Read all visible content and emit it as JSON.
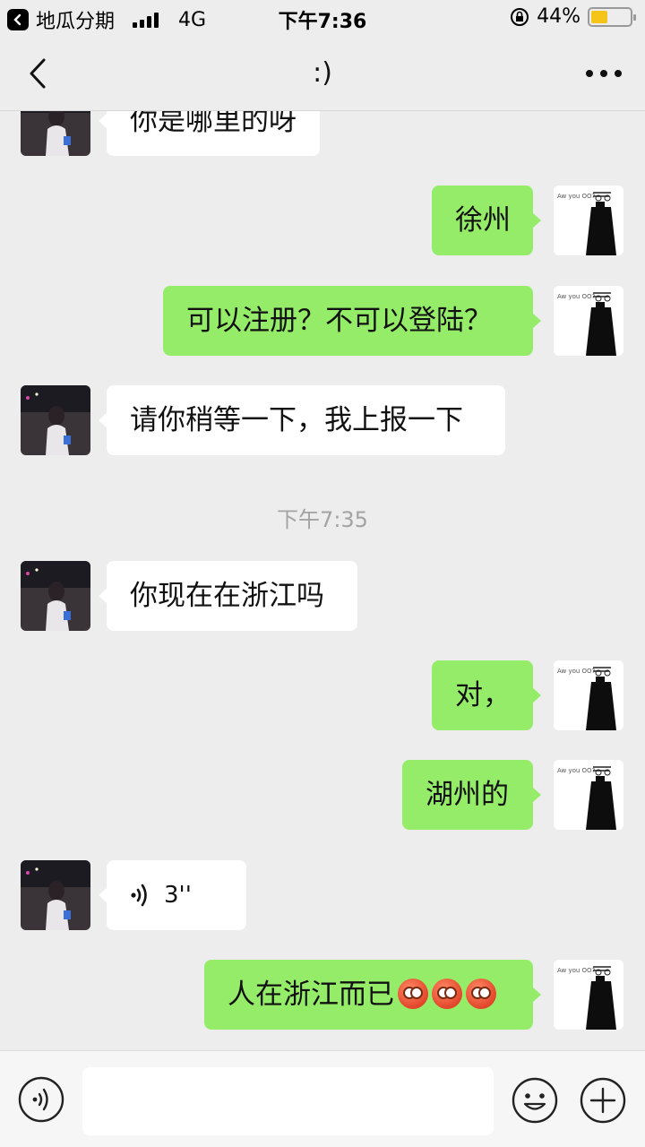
{
  "status_bar": {
    "carrier_app": "地瓜分期",
    "network": "4G",
    "time": "下午7:36",
    "battery_percent": "44%",
    "battery_level": 0.44
  },
  "nav": {
    "title": ":)"
  },
  "messages": [
    {
      "side": "left",
      "type": "text",
      "text": "你是哪里的呀"
    },
    {
      "side": "right",
      "type": "text",
      "text": "徐州"
    },
    {
      "side": "right",
      "type": "text",
      "text": "可以注册？不可以登陆？"
    },
    {
      "side": "left",
      "type": "text",
      "text": "请你稍等一下，我上报一下"
    },
    {
      "type": "timestamp",
      "text": "下午7:35"
    },
    {
      "side": "left",
      "type": "text",
      "text": "你现在在浙江吗"
    },
    {
      "side": "right",
      "type": "text",
      "text": "对，"
    },
    {
      "side": "right",
      "type": "text",
      "text": "湖州的"
    },
    {
      "side": "left",
      "type": "voice",
      "text": "3''"
    },
    {
      "side": "right",
      "type": "text",
      "text": "人在浙江而已",
      "emoji_count": 3,
      "emoji": "flushed-face-icon"
    }
  ],
  "input_bar": {
    "placeholder": ""
  },
  "colors": {
    "background": "#ededed",
    "bubble_self": "#95ec69",
    "bubble_other": "#ffffff",
    "timestamp": "#a3a3a3",
    "battery": "#f4c418"
  }
}
